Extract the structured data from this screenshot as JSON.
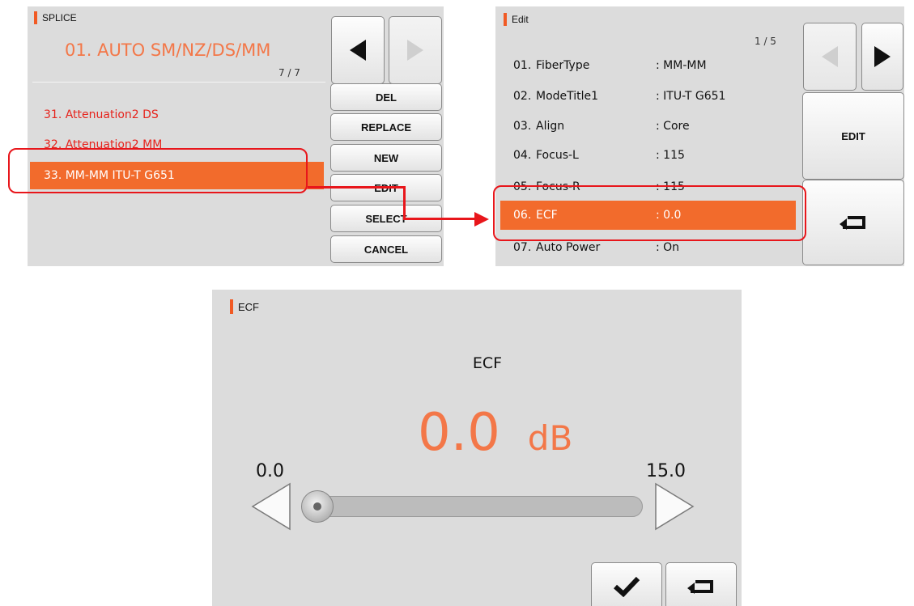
{
  "splice": {
    "title": "SPLICE",
    "mode_name": "01. AUTO SM/NZ/DS/MM",
    "page": "7 / 7",
    "items": [
      {
        "label": "31. Attenuation2 DS"
      },
      {
        "label": "32. Attenuation2 MM"
      }
    ],
    "selected_item": "33. MM-MM ITU-T G651",
    "buttons": {
      "del": "DEL",
      "replace": "REPLACE",
      "new": "NEW",
      "edit": "EDIT",
      "select": "SELECT",
      "cancel": "CANCEL"
    }
  },
  "edit": {
    "title": "Edit",
    "page": "1 / 5",
    "rows": [
      {
        "num": "01.",
        "name": "FiberType",
        "value": ": MM-MM"
      },
      {
        "num": "02.",
        "name": "ModeTitle1",
        "value": ": ITU-T G651"
      },
      {
        "num": "03.",
        "name": "Align",
        "value": ": Core"
      },
      {
        "num": "04.",
        "name": "Focus-L",
        "value": ": 115"
      },
      {
        "num": "05.",
        "name": "Focus-R",
        "value": ": 115"
      },
      {
        "num": "06.",
        "name": "ECF",
        "value": ": 0.0"
      },
      {
        "num": "07.",
        "name": "Auto Power",
        "value": ": On"
      }
    ],
    "edit_button": "EDIT"
  },
  "ecf": {
    "title": "ECF",
    "heading": "ECF",
    "value": "0.0",
    "unit": "dB",
    "min": "0.0",
    "max": "15.0",
    "slider_fraction": 0.0
  },
  "colors": {
    "accent": "#f26b2c",
    "highlight": "#e8161b",
    "panel_bg": "#dcdcdc"
  }
}
